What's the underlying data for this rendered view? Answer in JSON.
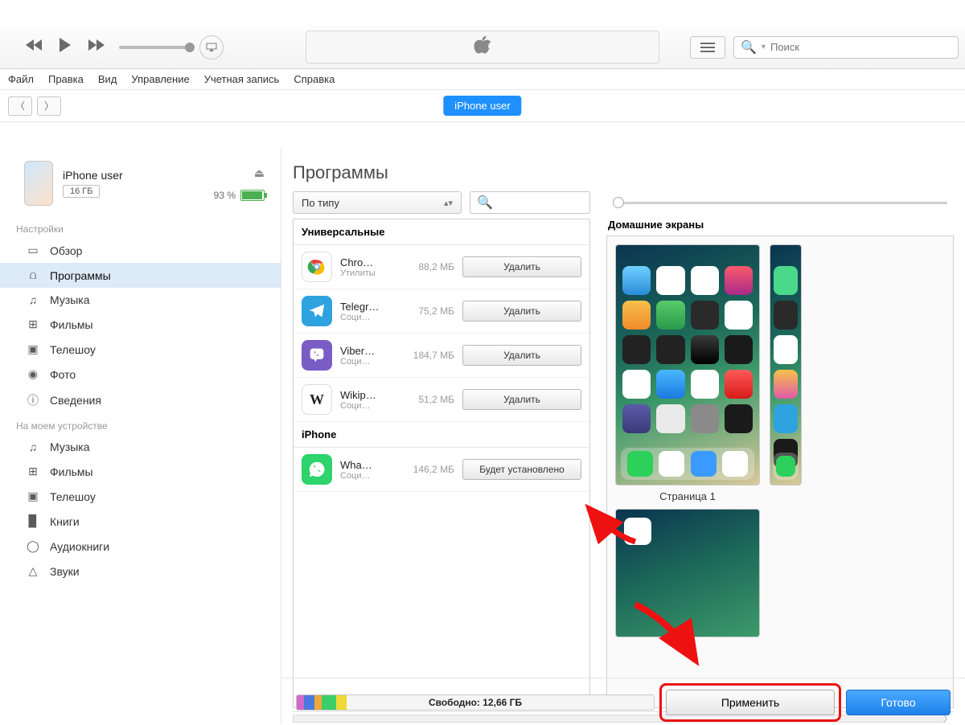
{
  "chrome": {
    "min": "—",
    "max": "☐",
    "close": "✕"
  },
  "search_placeholder": "Поиск",
  "menu": [
    "Файл",
    "Правка",
    "Вид",
    "Управление",
    "Учетная запись",
    "Справка"
  ],
  "device_pill": "iPhone user",
  "device": {
    "name": "iPhone user",
    "capacity": "16 ГБ",
    "battery": "93 %"
  },
  "sidebar": {
    "settings_header": "Настройки",
    "settings": [
      {
        "icon": "▭",
        "label": "Обзор"
      },
      {
        "icon": "⩍",
        "label": "Программы"
      },
      {
        "icon": "♫",
        "label": "Музыка"
      },
      {
        "icon": "⊞",
        "label": "Фильмы"
      },
      {
        "icon": "▣",
        "label": "Телешоу"
      },
      {
        "icon": "◉",
        "label": "Фото"
      },
      {
        "icon": "ⓘ",
        "label": "Сведения"
      }
    ],
    "ondevice_header": "На моем устройстве",
    "ondevice": [
      {
        "icon": "♫",
        "label": "Музыка"
      },
      {
        "icon": "⊞",
        "label": "Фильмы"
      },
      {
        "icon": "▣",
        "label": "Телешоу"
      },
      {
        "icon": "▉",
        "label": "Книги"
      },
      {
        "icon": "◯",
        "label": "Аудиокниги"
      },
      {
        "icon": "△",
        "label": "Звуки"
      }
    ]
  },
  "main": {
    "title": "Программы",
    "sort": "По типу",
    "section1": "Универсальные",
    "section2": "iPhone",
    "remove": "Удалить",
    "will_install": "Будет установлено",
    "apps": [
      {
        "name": "Chro…",
        "cat": "Утилиты",
        "size": "88,2 МБ",
        "color": "#fff",
        "ic": "chrome"
      },
      {
        "name": "Telegr…",
        "cat": "Соци…",
        "size": "75,2 МБ",
        "color": "#2fa3e0",
        "ic": "tg"
      },
      {
        "name": "Viber…",
        "cat": "Соци…",
        "size": "184,7 МБ",
        "color": "#7a5cc6",
        "ic": "vb"
      },
      {
        "name": "Wikip…",
        "cat": "Соци…",
        "size": "51,2 МБ",
        "color": "#fff",
        "ic": "wiki"
      }
    ],
    "iphone_apps": [
      {
        "name": "Wha…",
        "cat": "Соци…",
        "size": "146,2 МБ",
        "color": "#2cd46b",
        "ic": "wa"
      }
    ],
    "screens_label": "Домашние экраны",
    "page1": "Страница 1"
  },
  "bottom": {
    "free": "Свободно: 12,66 ГБ",
    "apply": "Применить",
    "done": "Готово"
  }
}
